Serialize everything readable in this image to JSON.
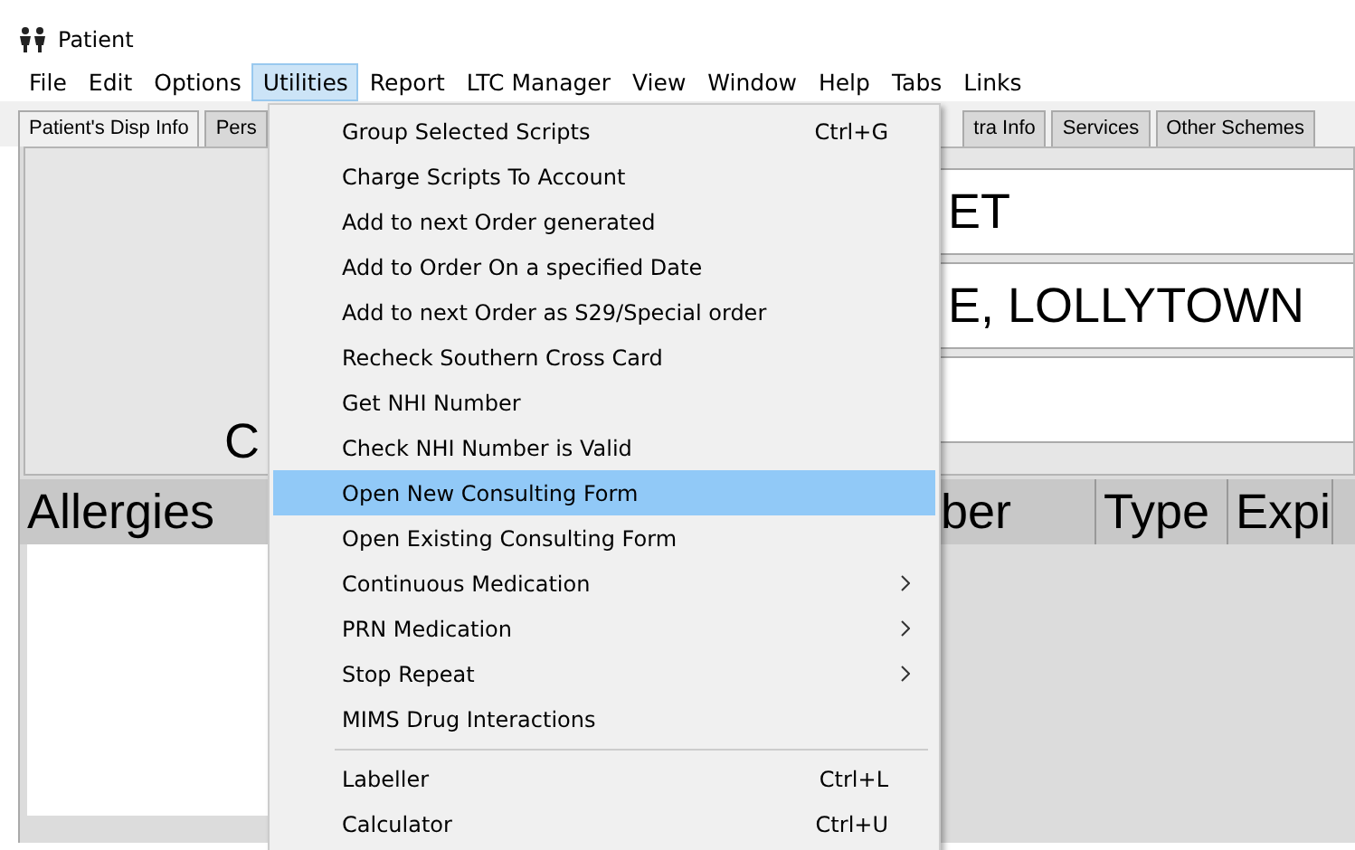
{
  "window": {
    "title": "Patient"
  },
  "menu_bar": [
    {
      "label": "File",
      "selected": false
    },
    {
      "label": "Edit",
      "selected": false
    },
    {
      "label": "Options",
      "selected": false
    },
    {
      "label": "Utilities",
      "selected": true
    },
    {
      "label": "Report",
      "selected": false
    },
    {
      "label": "LTC Manager",
      "selected": false
    },
    {
      "label": "View",
      "selected": false
    },
    {
      "label": "Window",
      "selected": false
    },
    {
      "label": "Help",
      "selected": false
    },
    {
      "label": "Tabs",
      "selected": false
    },
    {
      "label": "Links",
      "selected": false
    }
  ],
  "tabs_left": [
    {
      "label": "Patient's Disp Info",
      "selected": true
    },
    {
      "label": "Pers",
      "selected": false
    }
  ],
  "tabs_right": [
    {
      "label": "tra Info",
      "selected": false
    },
    {
      "label": "Services",
      "selected": false
    },
    {
      "label": "Other Schemes",
      "selected": false
    }
  ],
  "panel": {
    "label": "C",
    "fields": [
      {
        "value": "ET"
      },
      {
        "value": "E, LOLLYTOWN"
      }
    ]
  },
  "table": {
    "columns": [
      {
        "label": "Allergies",
        "kind": "left"
      },
      {
        "label": "ber",
        "kind": "right"
      },
      {
        "label": "Type",
        "kind": "right"
      },
      {
        "label": "Expi",
        "kind": "right"
      }
    ]
  },
  "dropdown": [
    {
      "kind": "item",
      "label": "Group Selected Scripts",
      "shortcut": "Ctrl+G",
      "submenu": false,
      "selected": false
    },
    {
      "kind": "item",
      "label": "Charge Scripts To Account",
      "submenu": false,
      "selected": false
    },
    {
      "kind": "item",
      "label": "Add to next Order generated",
      "submenu": false,
      "selected": false
    },
    {
      "kind": "item",
      "label": "Add to Order On a specified Date",
      "submenu": false,
      "selected": false
    },
    {
      "kind": "item",
      "label": "Add to next Order as S29/Special order",
      "submenu": false,
      "selected": false
    },
    {
      "kind": "item",
      "label": "Recheck Southern Cross Card",
      "submenu": false,
      "selected": false
    },
    {
      "kind": "item",
      "label": "Get NHI Number",
      "submenu": false,
      "selected": false
    },
    {
      "kind": "item",
      "label": "Check NHI Number is Valid",
      "submenu": false,
      "selected": false
    },
    {
      "kind": "item",
      "label": "Open New Consulting Form",
      "submenu": false,
      "selected": true
    },
    {
      "kind": "item",
      "label": "Open Existing Consulting Form",
      "submenu": false,
      "selected": false
    },
    {
      "kind": "item",
      "label": "Continuous Medication",
      "submenu": true,
      "selected": false
    },
    {
      "kind": "item",
      "label": "PRN Medication",
      "submenu": true,
      "selected": false
    },
    {
      "kind": "item",
      "label": "Stop Repeat",
      "submenu": true,
      "selected": false
    },
    {
      "kind": "item",
      "label": "MIMS Drug Interactions",
      "submenu": false,
      "selected": false
    },
    {
      "kind": "separator"
    },
    {
      "kind": "item",
      "label": "Labeller",
      "shortcut": "Ctrl+L",
      "submenu": false,
      "selected": false
    },
    {
      "kind": "item",
      "label": "Calculator",
      "shortcut": "Ctrl+U",
      "submenu": false,
      "selected": false
    }
  ]
}
